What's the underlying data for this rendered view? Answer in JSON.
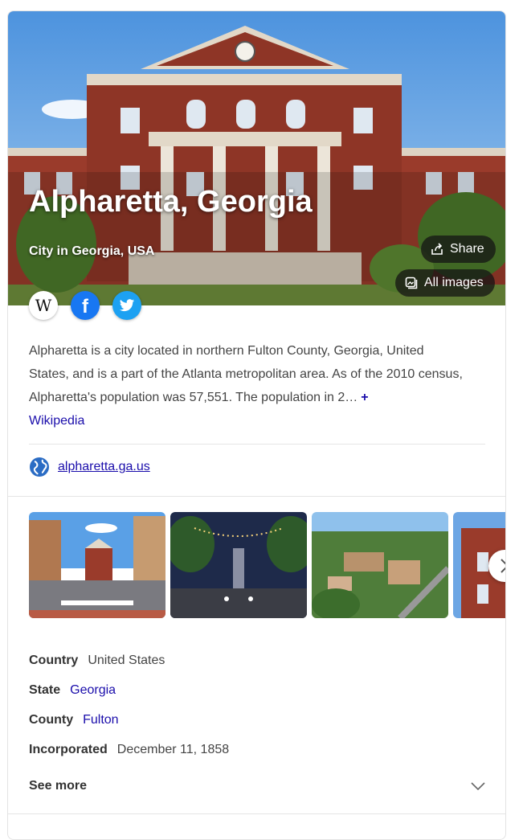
{
  "hero": {
    "title": "Alpharetta, Georgia",
    "subtitle": "City in Georgia, USA",
    "share_label": "Share",
    "all_images_label": "All images"
  },
  "social": [
    {
      "name": "wikipedia-icon"
    },
    {
      "name": "facebook-icon",
      "color": "#1877f2"
    },
    {
      "name": "twitter-icon",
      "color": "#1da1f2"
    }
  ],
  "description": {
    "text": "Alpharetta is a city located in northern Fulton County, Georgia, United States, and is a part of the Atlanta metropolitan area. As of the 2010 census, Alpharetta's population was 57,551. The population in 2…",
    "source": "Wikipedia"
  },
  "website": "alpharetta.ga.us",
  "facts": [
    {
      "key": "Country",
      "value": "United States",
      "link": false
    },
    {
      "key": "State",
      "value": "Georgia",
      "link": true
    },
    {
      "key": "County",
      "value": "Fulton",
      "link": true
    },
    {
      "key": "Incorporated",
      "value": "December 11, 1858",
      "link": false
    }
  ],
  "see_more": "See more",
  "colors": {
    "link": "#1a0dab",
    "brick": "#9a3b2b"
  }
}
